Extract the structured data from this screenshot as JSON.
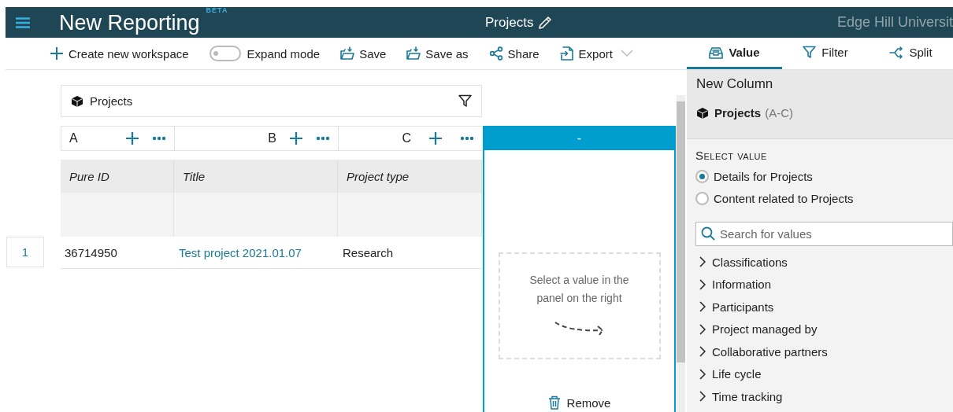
{
  "header": {
    "app_title": "New Reporting",
    "badge": "BETA",
    "report_title": "Projects",
    "organisation": "Edge Hill Universit"
  },
  "toolbar": [
    {
      "kind": "create",
      "label": "Create new workspace"
    },
    {
      "kind": "toggle",
      "label": "Expand mode",
      "on": false
    },
    {
      "kind": "save",
      "label": "Save"
    },
    {
      "kind": "saveas",
      "label": "Save as"
    },
    {
      "kind": "share",
      "label": "Share"
    },
    {
      "kind": "export",
      "label": "Export"
    }
  ],
  "panel_tabs": [
    {
      "kind": "value",
      "label": "Value",
      "selected": true
    },
    {
      "kind": "filter",
      "label": "Filter",
      "selected": false
    },
    {
      "kind": "split",
      "label": "Split",
      "selected": false
    }
  ],
  "source": {
    "label": "Projects"
  },
  "columns": [
    {
      "letter": "A",
      "heading": "Pure ID"
    },
    {
      "letter": "B",
      "heading": "Title"
    },
    {
      "letter": "C",
      "heading": "Project type"
    }
  ],
  "rows": [
    {
      "number": "1",
      "cells": [
        {
          "kind": "text",
          "text": "36714950"
        },
        {
          "kind": "link",
          "text": "Test project 2021.01.07"
        },
        {
          "kind": "text",
          "text": "Research"
        }
      ]
    }
  ],
  "new_column": {
    "header": "-",
    "hint": "Select a value in the panel on the right",
    "remove": "Remove"
  },
  "panel": {
    "title": "New Column",
    "source": "Projects",
    "range": "(A-C)",
    "section_label": "Select value",
    "options": [
      {
        "label": "Details for Projects",
        "selected": true
      },
      {
        "label": "Content related to Projects",
        "selected": false
      }
    ],
    "search": {
      "placeholder": "Search for values"
    },
    "categories": [
      {
        "label": "Classifications",
        "expanded": false
      },
      {
        "label": "Information",
        "expanded": false
      },
      {
        "label": "Participants",
        "expanded": false
      },
      {
        "label": "Project managed by",
        "expanded": false
      },
      {
        "label": "Collaborative partners",
        "expanded": false
      },
      {
        "label": "Life cycle",
        "expanded": false
      },
      {
        "label": "Time tracking",
        "expanded": false
      }
    ]
  }
}
